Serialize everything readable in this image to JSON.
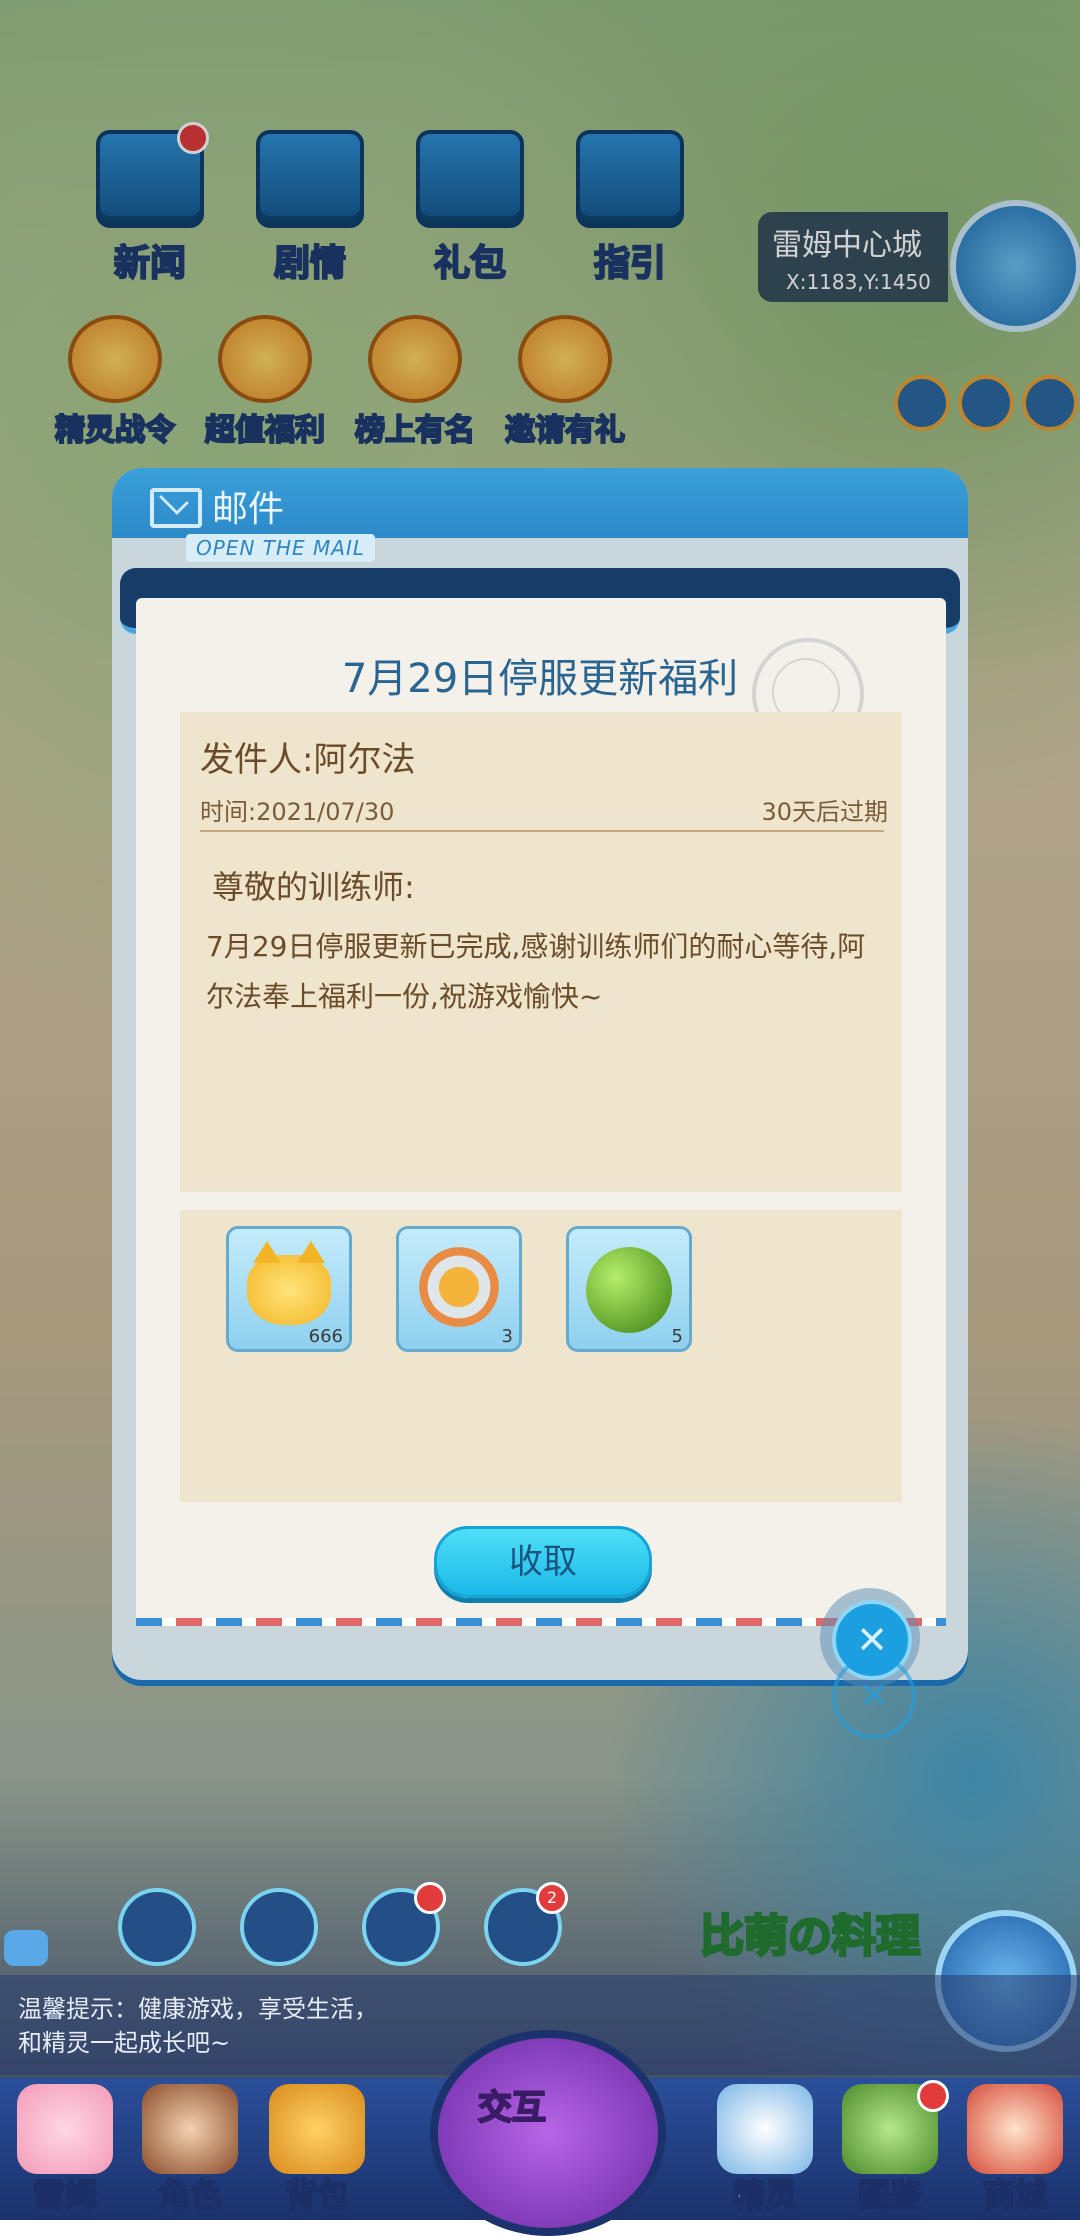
{
  "top_menu": {
    "items": [
      {
        "label": "新闻"
      },
      {
        "label": "剧情"
      },
      {
        "label": "礼包"
      },
      {
        "label": "指引"
      }
    ]
  },
  "second_menu": {
    "items": [
      {
        "label": "精灵战令"
      },
      {
        "label": "超值福利"
      },
      {
        "label": "榜上有名"
      },
      {
        "label": "邀请有礼"
      }
    ]
  },
  "location": {
    "city": "雷姆中心城",
    "coordinates": "X:1183,Y:1450"
  },
  "mail_dialog": {
    "title": "邮件",
    "open_tag": "OPEN THE MAIL",
    "subject": "7月29日停服更新福利",
    "sender": "发件人:阿尔法",
    "time": "时间:2021/07/30",
    "expire": "30天后过期",
    "greeting": "尊敬的训练师:",
    "body": "7月29日停服更新已完成,感谢训练师们的耐心等待,阿尔法奉上福利一份,祝游戏愉快~",
    "rewards": [
      {
        "item": "cat-face-token",
        "count": "666"
      },
      {
        "item": "energy-medal",
        "count": "3"
      },
      {
        "item": "green-fruit",
        "count": "5"
      }
    ],
    "claim_label": "收取",
    "close_symbol": "✕"
  },
  "lower_banner": "比萌の料理",
  "notifications": {
    "bell_count": "2"
  },
  "tip": {
    "line1": "温馨提示：健康游戏，享受生活，",
    "line2": "和精灵一起成长吧~"
  },
  "bottom_nav": {
    "items": [
      {
        "label": "雷姆"
      },
      {
        "label": "角色"
      },
      {
        "label": "背包"
      },
      {
        "label": "精灵"
      },
      {
        "label": "图鉴"
      },
      {
        "label": "商城"
      }
    ],
    "center_label": "交互"
  },
  "colors": {
    "accent": "#1ab8e8",
    "dialog_header": "#2c89c9",
    "text_brown": "#6b4c2a",
    "subject_blue": "#2a6592"
  }
}
